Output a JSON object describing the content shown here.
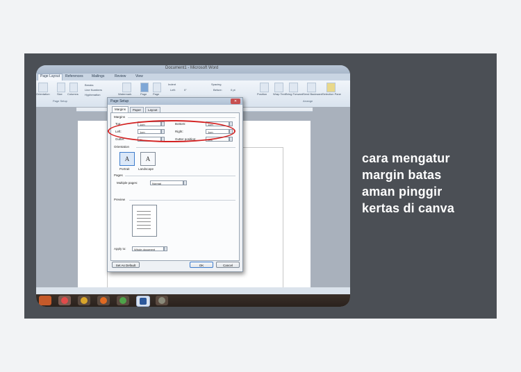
{
  "caption": {
    "lines": [
      "cara mengatur",
      "margin batas",
      "aman pinggir",
      "kertas di canva"
    ]
  },
  "word": {
    "title": "Document1 - Microsoft Word",
    "tabs": [
      "Page Layout",
      "References",
      "Mailings",
      "Review",
      "View"
    ],
    "ribbon": {
      "themes": "Orientation",
      "size": "Size",
      "columns": "Columns",
      "breaks": "Breaks",
      "line_numbers": "Line Numbers",
      "hyphenation": "Hyphenation",
      "watermark": "Watermark",
      "page_color": "Page",
      "page_borders": "Page",
      "indent_label": "Indent",
      "indent_left": "Left:",
      "indent_left_val": "0\"",
      "spacing_label": "Spacing",
      "spacing_before": "Before:",
      "spacing_before_val": "0 pt",
      "position": "Position",
      "wrap_text": "Wrap Text",
      "bring_forward": "Bring Forward",
      "send_backward": "Send Backward",
      "selection_pane": "Selection Pane",
      "group_page_setup": "Page Setup",
      "group_arrange": "Arrange"
    }
  },
  "dialog": {
    "title": "Page Setup",
    "tabs": [
      "Margins",
      "Paper",
      "Layout"
    ],
    "margins_section": "Margins",
    "top_label": "Top:",
    "top_value": "1cm",
    "bottom_label": "Bottom:",
    "bottom_value": "1cm",
    "left_label": "Left:",
    "left_value": "1cm",
    "right_label": "Right:",
    "right_value": "1cm",
    "gutter_label": "Gutter:",
    "gutter_value": "0\"",
    "gutter_position_label": "Gutter position:",
    "gutter_position_value": "Left",
    "orientation_section": "Orientation",
    "portrait": "Portrait",
    "landscape": "Landscape",
    "pages_section": "Pages",
    "multiple_pages_label": "Multiple pages:",
    "multiple_pages_value": "Normal",
    "preview_section": "Preview",
    "apply_to_label": "Apply to:",
    "apply_to_value": "Whole document",
    "set_default": "Set As Default",
    "ok": "OK",
    "cancel": "Cancel"
  },
  "colors": {
    "background": "#f2f3f5",
    "card": "#4b4f55",
    "caption_text": "#ffffff",
    "highlight_ellipse": "#d32222"
  }
}
